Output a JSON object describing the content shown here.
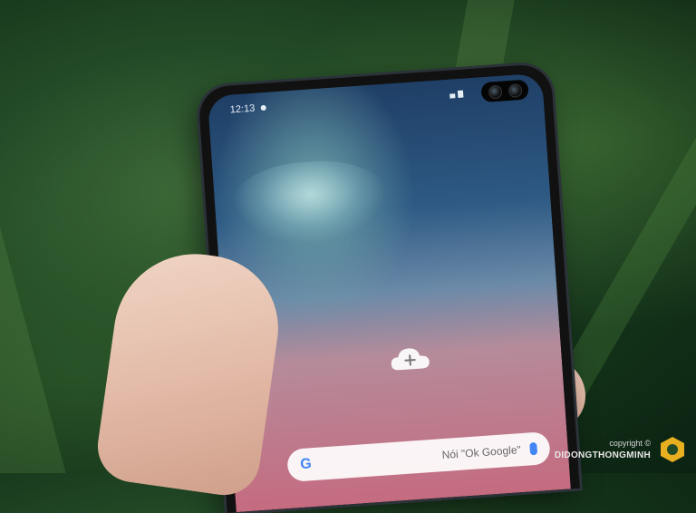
{
  "phone": {
    "status_time": "12:13"
  },
  "search": {
    "placeholder": "Nói \"Ok Google\""
  },
  "watermark": {
    "copyright": "copyright ©",
    "brand": "DIDONGTHONGMINH"
  },
  "colors": {
    "background": "#234a26",
    "accent": "#e8b020"
  }
}
